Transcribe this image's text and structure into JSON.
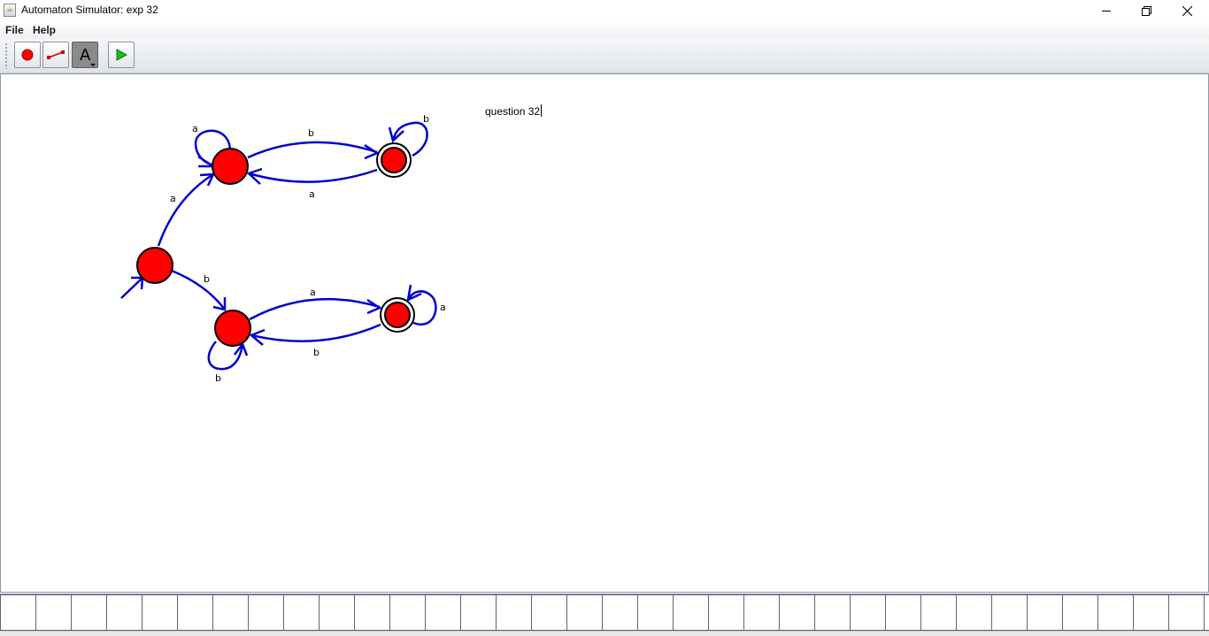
{
  "window": {
    "title": "Automaton Simulator: exp 32",
    "app_icon": "java-cup-icon",
    "controls": [
      "minimize-icon",
      "restore-icon",
      "close-icon"
    ]
  },
  "menu": {
    "file": "File",
    "help": "Help"
  },
  "toolbar": {
    "tools": [
      {
        "name": "add-state-tool",
        "icon": "red-circle-icon"
      },
      {
        "name": "add-transition-tool",
        "icon": "arrow-line-icon"
      },
      {
        "name": "text-tool",
        "icon": "text-a-icon",
        "selected": true
      },
      {
        "name": "run-tool",
        "icon": "green-play-icon"
      }
    ],
    "text_tool_glyph": "A",
    "colors": {
      "state_fill": "#ff0000",
      "play": "#18c018",
      "selected_bg": "#8a8a8a"
    }
  },
  "canvas": {
    "note_text": "question 32",
    "colors": {
      "state": "#ff0000",
      "edge": "#0000d0",
      "outline": "#000000"
    },
    "states": [
      {
        "id": "q0",
        "start": true,
        "accepting": false
      },
      {
        "id": "q1",
        "start": false,
        "accepting": false
      },
      {
        "id": "q2",
        "start": false,
        "accepting": true
      },
      {
        "id": "q3",
        "start": false,
        "accepting": false
      },
      {
        "id": "q4",
        "start": false,
        "accepting": true
      }
    ],
    "transitions": [
      {
        "from": "q0",
        "to": "q1",
        "label": "a"
      },
      {
        "from": "q0",
        "to": "q3",
        "label": "b"
      },
      {
        "from": "q1",
        "to": "q1",
        "label": "a"
      },
      {
        "from": "q1",
        "to": "q2",
        "label": "b"
      },
      {
        "from": "q2",
        "to": "q1",
        "label": "a"
      },
      {
        "from": "q2",
        "to": "q2",
        "label": "b"
      },
      {
        "from": "q3",
        "to": "q4",
        "label": "a"
      },
      {
        "from": "q3",
        "to": "q3",
        "label": "b"
      },
      {
        "from": "q4",
        "to": "q3",
        "label": "b"
      },
      {
        "from": "q4",
        "to": "q4",
        "label": "a"
      }
    ]
  },
  "tape": {
    "cell_count": 35,
    "cells": []
  }
}
